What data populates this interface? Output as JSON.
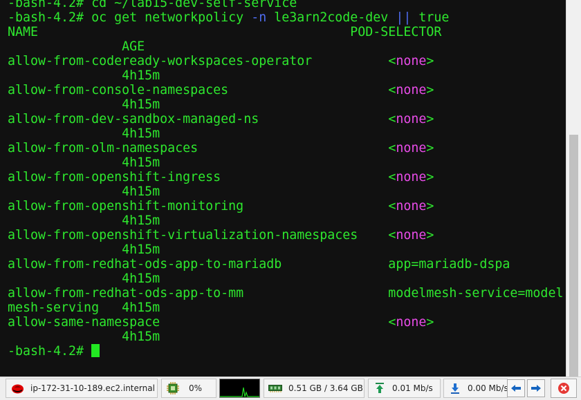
{
  "terminal": {
    "lines": [
      [
        {
          "t": "-bash-4.2# cd ~/lab15-dev-self-service"
        }
      ],
      [
        {
          "t": "-bash-4.2# oc get networkpolicy "
        },
        {
          "t": "-n",
          "c": "blu"
        },
        {
          "t": " le3arn2code-dev "
        },
        {
          "t": "||",
          "c": "blu"
        },
        {
          "t": " true"
        }
      ],
      [
        {
          "t": "NAME                                         POD-SELECTOR"
        }
      ],
      [
        {
          "t": "               AGE"
        }
      ],
      [
        {
          "t": "allow-from-codeready-workspaces-operator          "
        },
        {
          "t": "<"
        },
        {
          "t": "none",
          "c": "mag"
        },
        {
          "t": ">"
        }
      ],
      [
        {
          "t": "               4h15m"
        }
      ],
      [
        {
          "t": "allow-from-console-namespaces                     "
        },
        {
          "t": "<"
        },
        {
          "t": "none",
          "c": "mag"
        },
        {
          "t": ">"
        }
      ],
      [
        {
          "t": "               4h15m"
        }
      ],
      [
        {
          "t": "allow-from-dev-sandbox-managed-ns                 "
        },
        {
          "t": "<"
        },
        {
          "t": "none",
          "c": "mag"
        },
        {
          "t": ">"
        }
      ],
      [
        {
          "t": "               4h15m"
        }
      ],
      [
        {
          "t": "allow-from-olm-namespaces                         "
        },
        {
          "t": "<"
        },
        {
          "t": "none",
          "c": "mag"
        },
        {
          "t": ">"
        }
      ],
      [
        {
          "t": "               4h15m"
        }
      ],
      [
        {
          "t": "allow-from-openshift-ingress                      "
        },
        {
          "t": "<"
        },
        {
          "t": "none",
          "c": "mag"
        },
        {
          "t": ">"
        }
      ],
      [
        {
          "t": "               4h15m"
        }
      ],
      [
        {
          "t": "allow-from-openshift-monitoring                   "
        },
        {
          "t": "<"
        },
        {
          "t": "none",
          "c": "mag"
        },
        {
          "t": ">"
        }
      ],
      [
        {
          "t": "               4h15m"
        }
      ],
      [
        {
          "t": "allow-from-openshift-virtualization-namespaces    "
        },
        {
          "t": "<"
        },
        {
          "t": "none",
          "c": "mag"
        },
        {
          "t": ">"
        }
      ],
      [
        {
          "t": "               4h15m"
        }
      ],
      [
        {
          "t": "allow-from-redhat-ods-app-to-mariadb              app=mariadb-dspa"
        }
      ],
      [
        {
          "t": "               4h15m"
        }
      ],
      [
        {
          "t": "allow-from-redhat-ods-app-to-mm                   modelmesh-service=model"
        }
      ],
      [
        {
          "t": "mesh-serving   4h15m"
        }
      ],
      [
        {
          "t": "allow-same-namespace                              "
        },
        {
          "t": "<"
        },
        {
          "t": "none",
          "c": "mag"
        },
        {
          "t": ">"
        }
      ],
      [
        {
          "t": "               4h15m"
        }
      ],
      [
        {
          "t": "-bash-4.2# "
        }
      ]
    ]
  },
  "statusbar": {
    "host": "ip-172-31-10-189.ec2.internal",
    "cpu": "0%",
    "memory": "0.51 GB / 3.64 GB",
    "upload": "0.01 Mb/s",
    "download": "0.00 Mb/s"
  },
  "icons": {
    "host": "redhat-logo-icon",
    "cpu": "cpu-chip-icon",
    "memory": "memory-icon",
    "upload": "upload-arrow-icon",
    "download": "download-arrow-icon",
    "prev": "arrow-left-icon",
    "next": "arrow-right-icon",
    "close": "close-icon"
  },
  "colors": {
    "terminal_bg": "#111111",
    "text_green": "#2ee82e",
    "text_magenta": "#e84ce8",
    "text_blue": "#4f6cf0",
    "cursor": "#22e822",
    "close_red": "#e53935",
    "arrow_blue": "#1565c0"
  }
}
